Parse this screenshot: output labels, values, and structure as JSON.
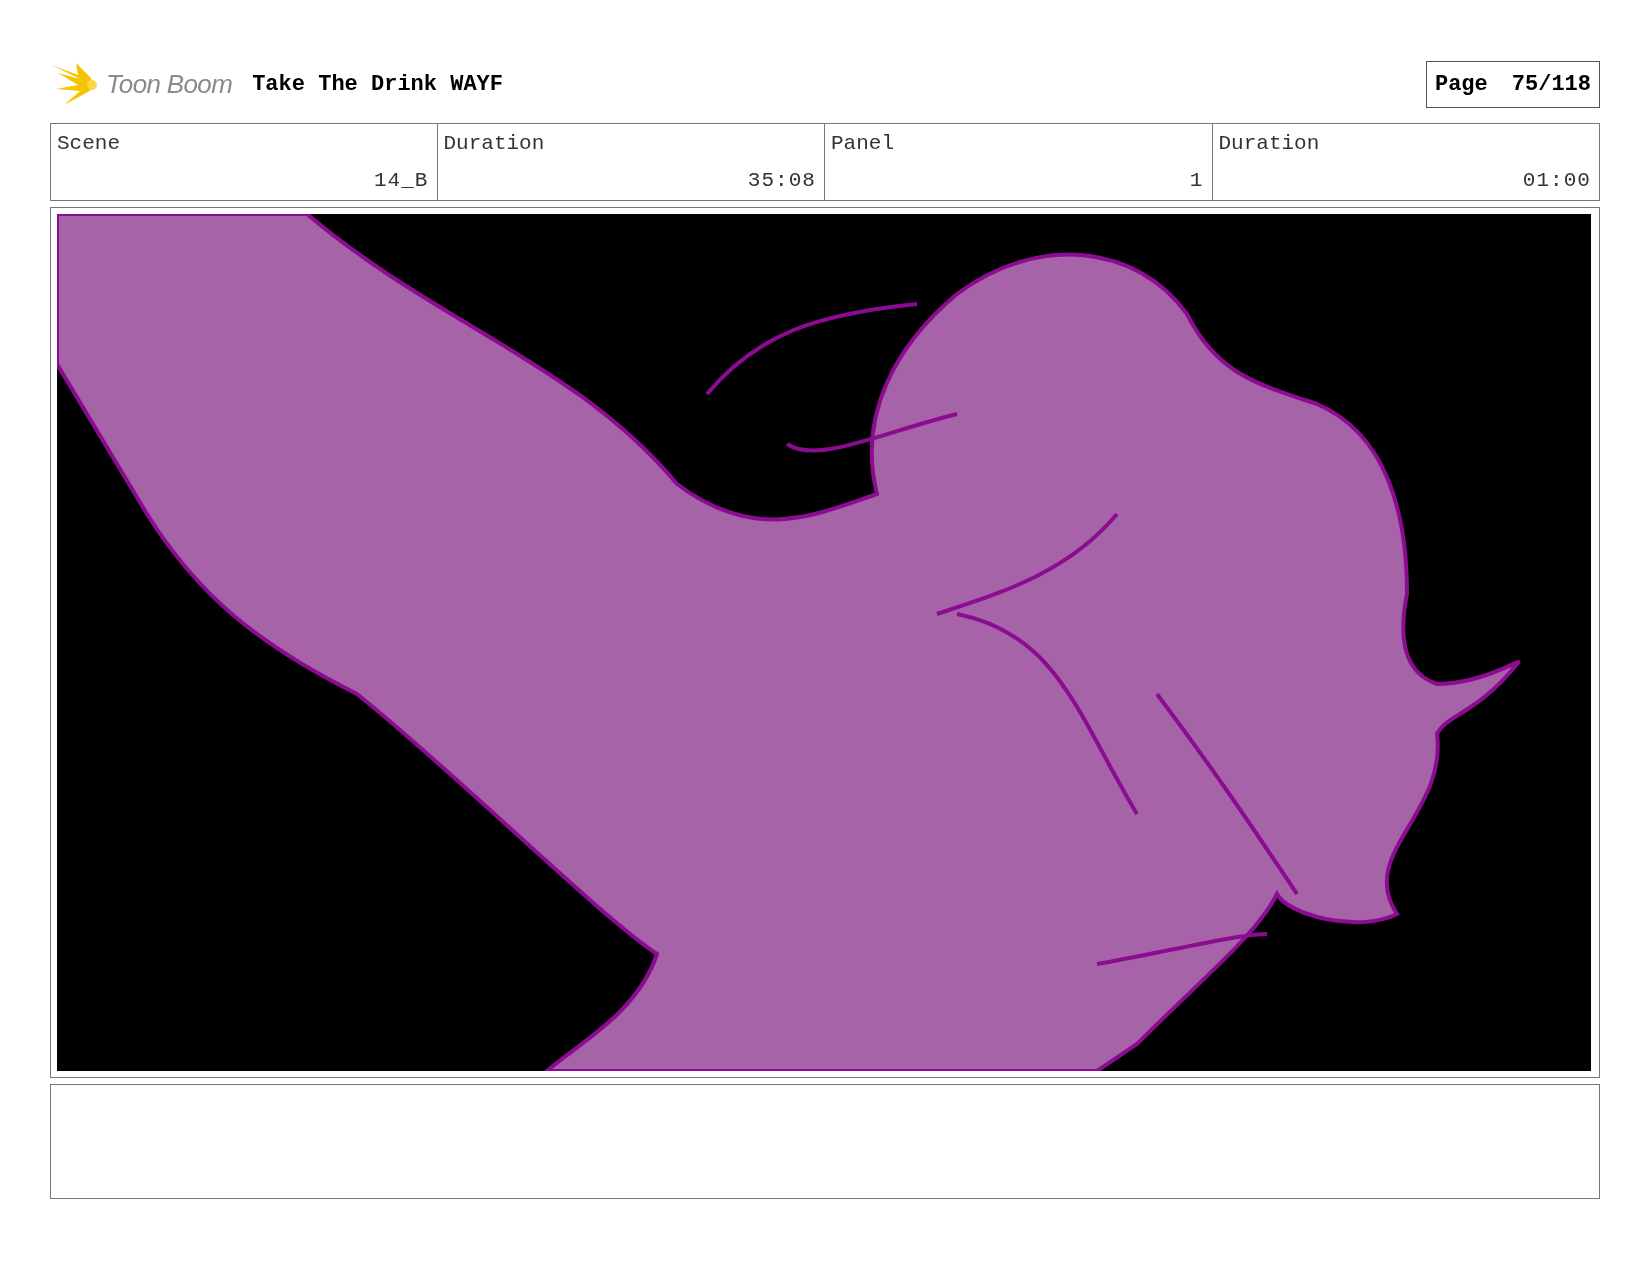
{
  "header": {
    "logo_text": "Toon Boom",
    "title": "Take The Drink WAYF",
    "page_label": "Page",
    "page_number": "75/118"
  },
  "info_labels": [
    "Scene",
    "Duration",
    "Panel",
    "Duration"
  ],
  "info_values": [
    "14_B",
    "35:08",
    "1",
    "01:00"
  ]
}
